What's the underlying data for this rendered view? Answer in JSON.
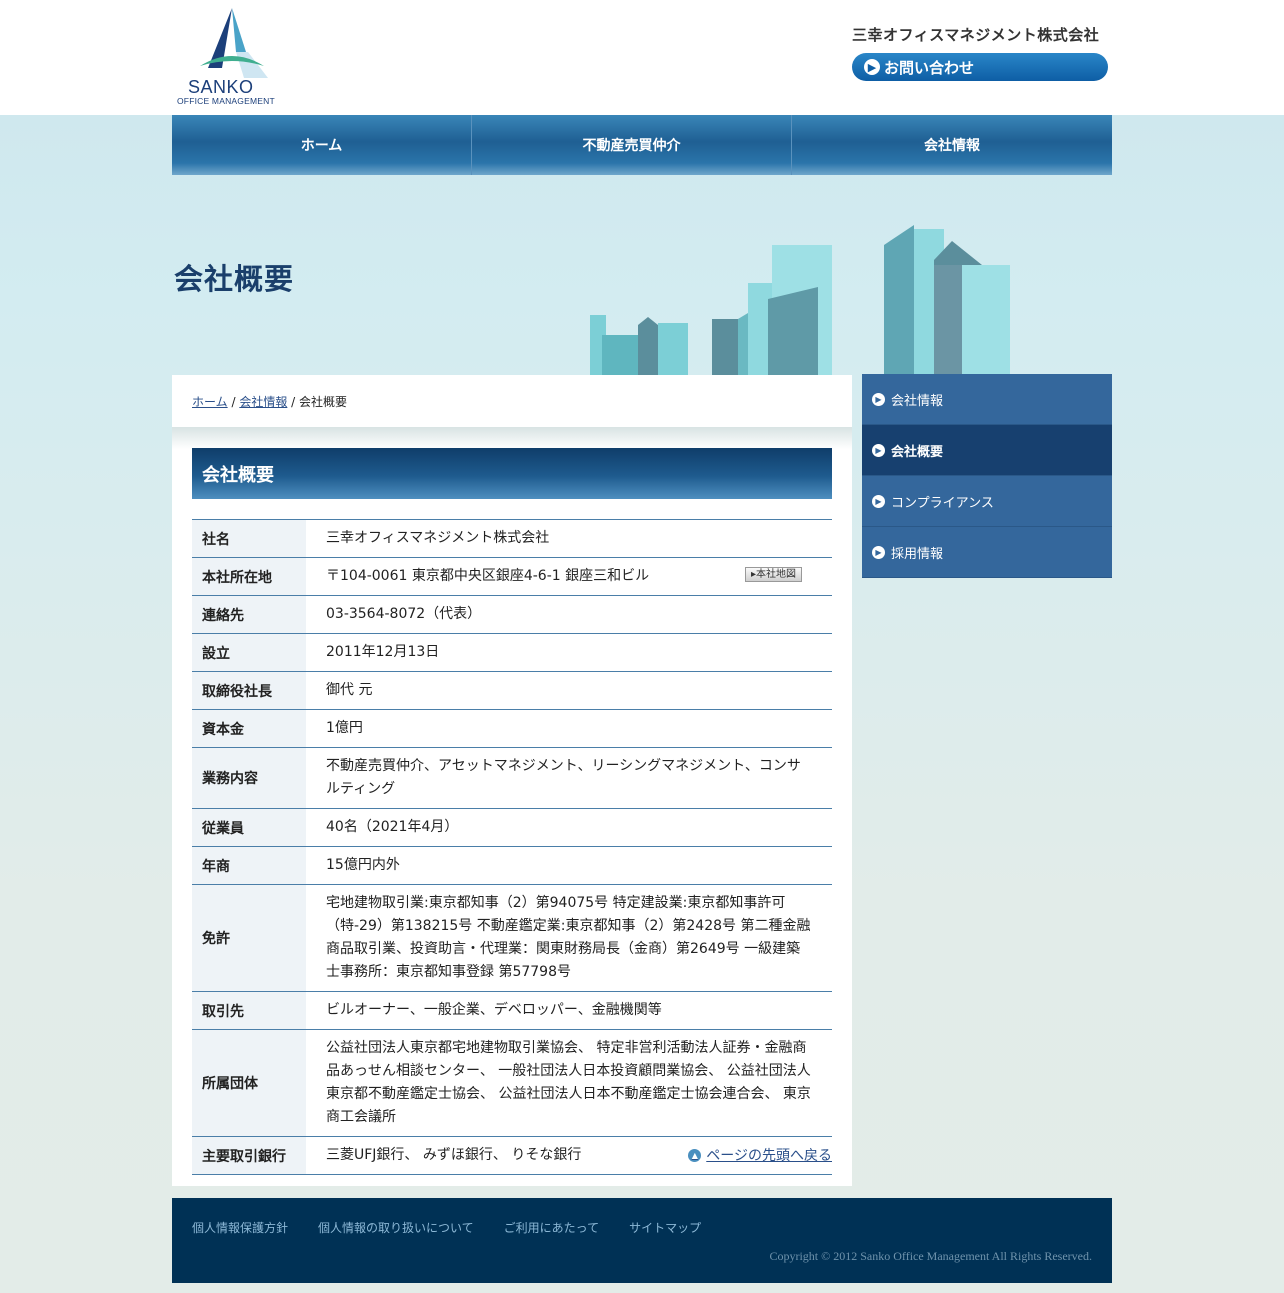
{
  "header": {
    "logo_name": "SANKO",
    "logo_sub": "OFFICE MANAGEMENT",
    "company_name": "三幸オフィスマネジメント株式会社",
    "contact_label": "お問い合わせ"
  },
  "nav": {
    "items": [
      "ホーム",
      "不動産売買仲介",
      "会社情報"
    ]
  },
  "page": {
    "heading": "会社概要"
  },
  "breadcrumb": {
    "home": "ホーム",
    "sep1": " /",
    "company": "会社情報",
    "current": " / 会社概要"
  },
  "section": {
    "title": "会社概要",
    "map_button": "▸本社地図",
    "page_top": "ページの先頭へ戻る"
  },
  "profile": [
    {
      "label": "社名",
      "value": "三幸オフィスマネジメント株式会社"
    },
    {
      "label": "本社所在地",
      "value": "〒104-0061 東京都中央区銀座4-6-1 銀座三和ビル"
    },
    {
      "label": "連絡先",
      "value": "03-3564-8072（代表）"
    },
    {
      "label": "設立",
      "value": "2011年12月13日"
    },
    {
      "label": "取締役社長",
      "value": "御代 元"
    },
    {
      "label": "資本金",
      "value": "1億円"
    },
    {
      "label": "業務内容",
      "value": "不動産売買仲介、アセットマネジメント、リーシングマネジメント、コンサルティング"
    },
    {
      "label": "従業員",
      "value": "40名（2021年4月）"
    },
    {
      "label": "年商",
      "value": "15億円内外"
    },
    {
      "label": "免許",
      "value": "宅地建物取引業:東京都知事（2）第94075号 特定建設業:東京都知事許可（特-29）第138215号 不動産鑑定業:東京都知事（2）第2428号 第二種金融商品取引業、投資助言・代理業：関東財務局長（金商）第2649号 一級建築士事務所：東京都知事登録 第57798号"
    },
    {
      "label": "取引先",
      "value": "ビルオーナー、一般企業、デベロッパー、金融機関等"
    },
    {
      "label": "所属団体",
      "value": "公益社団法人東京都宅地建物取引業協会、 特定非営利活動法人証券・金融商品あっせん相談センター、 一般社団法人日本投資顧問業協会、 公益社団法人東京都不動産鑑定士協会、 公益社団法人日本不動産鑑定士協会連合会、 東京商工会議所"
    },
    {
      "label": "主要取引銀行",
      "value": "三菱UFJ銀行、 みずほ銀行、 りそな銀行"
    }
  ],
  "sidebar": {
    "items": [
      "会社情報",
      "会社概要",
      "コンプライアンス",
      "採用情報"
    ],
    "active": "会社概要"
  },
  "footer": {
    "links": [
      "個人情報保護方針",
      "個人情報の取り扱いについて",
      "ご利用にあたって",
      "サイトマップ"
    ],
    "copyright": "Copyright © 2012 Sanko Office Management All Rights Reserved."
  },
  "colors": {
    "primary": "#17406f",
    "nav": "#1f5f93",
    "footer": "#003155",
    "accent": "#0e5ea5"
  }
}
